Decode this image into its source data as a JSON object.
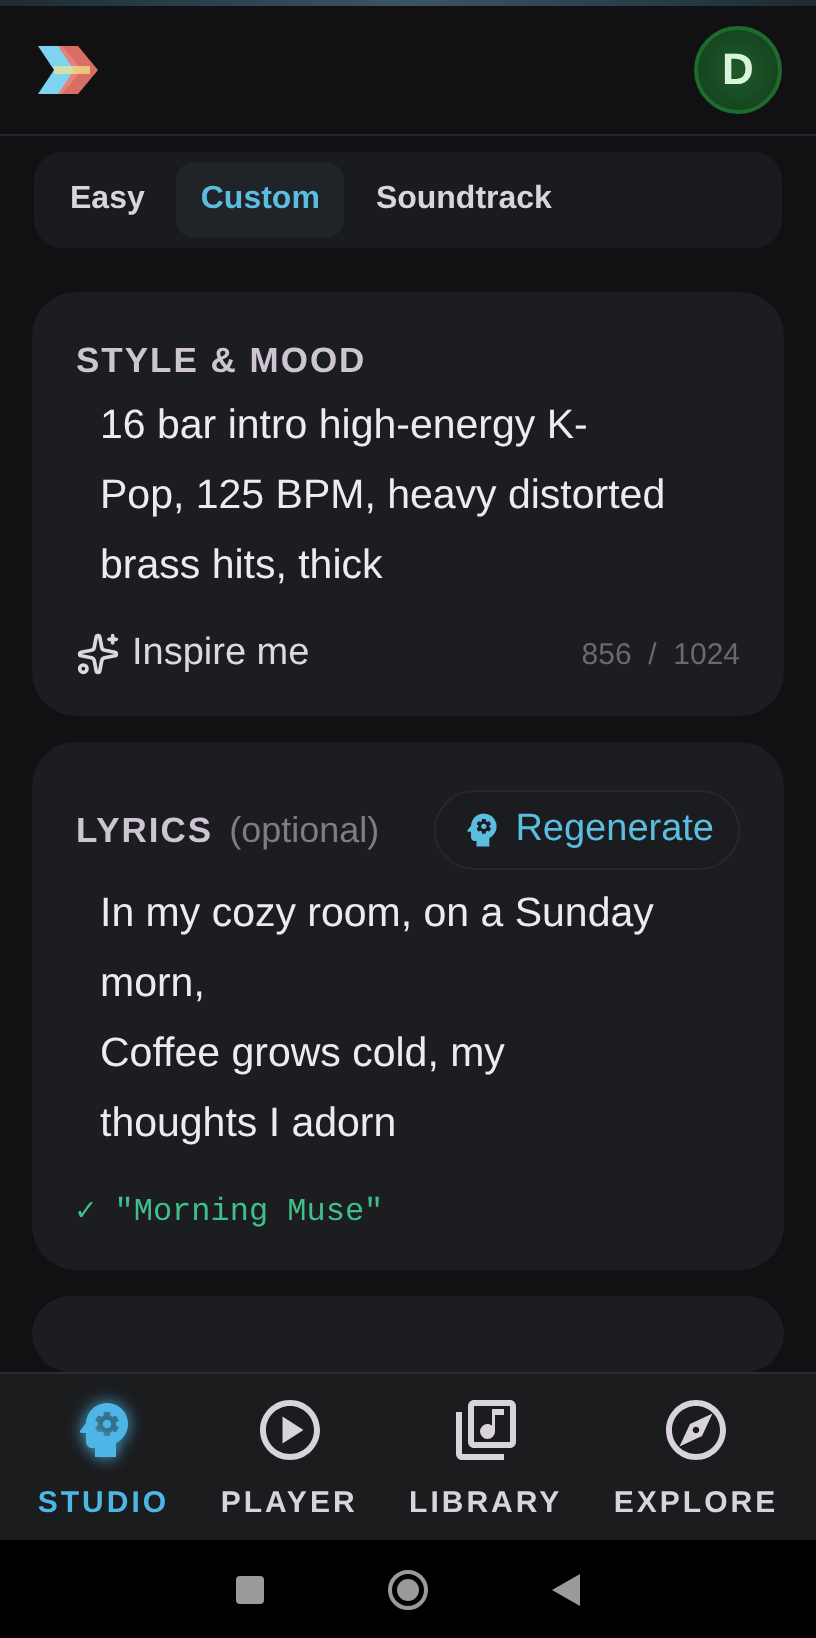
{
  "avatar": {
    "initial": "D"
  },
  "mode_tabs": [
    {
      "label": "Easy",
      "selected": false
    },
    {
      "label": "Custom",
      "selected": true
    },
    {
      "label": "Soundtrack",
      "selected": false
    }
  ],
  "style_card": {
    "title": "STYLE & MOOD",
    "value": "16 bar intro high-energy K-Pop, 125 BPM, heavy distorted brass hits, thick",
    "inspire_label": "Inspire me",
    "counter": "856  /  1024"
  },
  "lyrics_card": {
    "title": "LYRICS",
    "hint": "(optional)",
    "regenerate_label": "Regenerate",
    "lines": [
      "In my cozy room, on a Sunday morn,",
      "Coffee grows cold, my thoughts I adorn"
    ],
    "status": "✓ \"Morning Muse\""
  },
  "bottom_nav": [
    {
      "label": "STUDIO",
      "selected": true
    },
    {
      "label": "PLAYER",
      "selected": false
    },
    {
      "label": "LIBRARY",
      "selected": false
    },
    {
      "label": "EXPLORE",
      "selected": false
    }
  ]
}
